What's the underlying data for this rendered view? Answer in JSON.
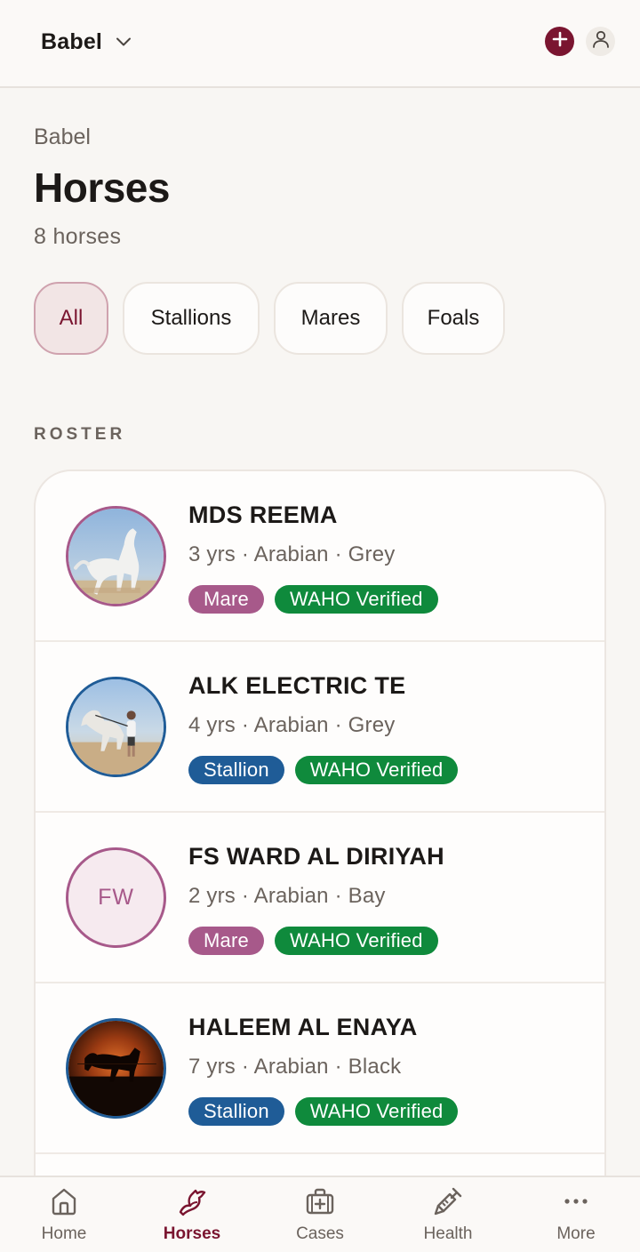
{
  "topbar": {
    "org_name": "Babel",
    "accent": "#7a1530"
  },
  "header": {
    "breadcrumb": "Babel",
    "title": "Horses",
    "count": "8 horses"
  },
  "filters": [
    "All",
    "Stallions",
    "Mares",
    "Foals"
  ],
  "filters_selected": "All",
  "section_label": "ROSTER",
  "horses": [
    {
      "name": "MDS REEMA",
      "meta": "3 yrs · Arabian · Grey",
      "sex": "Mare",
      "verified": "WAHO Verified",
      "avatar": "photo-grey-mare"
    },
    {
      "name": "ALK ELECTRIC TE",
      "meta": "4 yrs · Arabian · Grey",
      "sex": "Stallion",
      "verified": "WAHO Verified",
      "avatar": "photo-stallion-handler"
    },
    {
      "name": "FS WARD AL DIRIYAH",
      "meta": "2 yrs · Arabian · Bay",
      "sex": "Mare",
      "verified": "WAHO Verified",
      "avatar": "initials",
      "initials": "FW"
    },
    {
      "name": "HALEEM AL ENAYA",
      "meta": "7 yrs · Arabian · Black",
      "sex": "Stallion",
      "verified": "WAHO Verified",
      "avatar": "photo-sunset-silhouette"
    }
  ],
  "colors": {
    "mare": "#a7598a",
    "stallion": "#1f5c97",
    "verified": "#0f8a3c"
  },
  "bottom_nav": [
    {
      "label": "Home",
      "icon": "home-icon"
    },
    {
      "label": "Horses",
      "icon": "horse-icon",
      "active": true
    },
    {
      "label": "Cases",
      "icon": "medical-case-icon"
    },
    {
      "label": "Health",
      "icon": "syringe-icon"
    },
    {
      "label": "More",
      "icon": "more-dots-icon"
    }
  ]
}
